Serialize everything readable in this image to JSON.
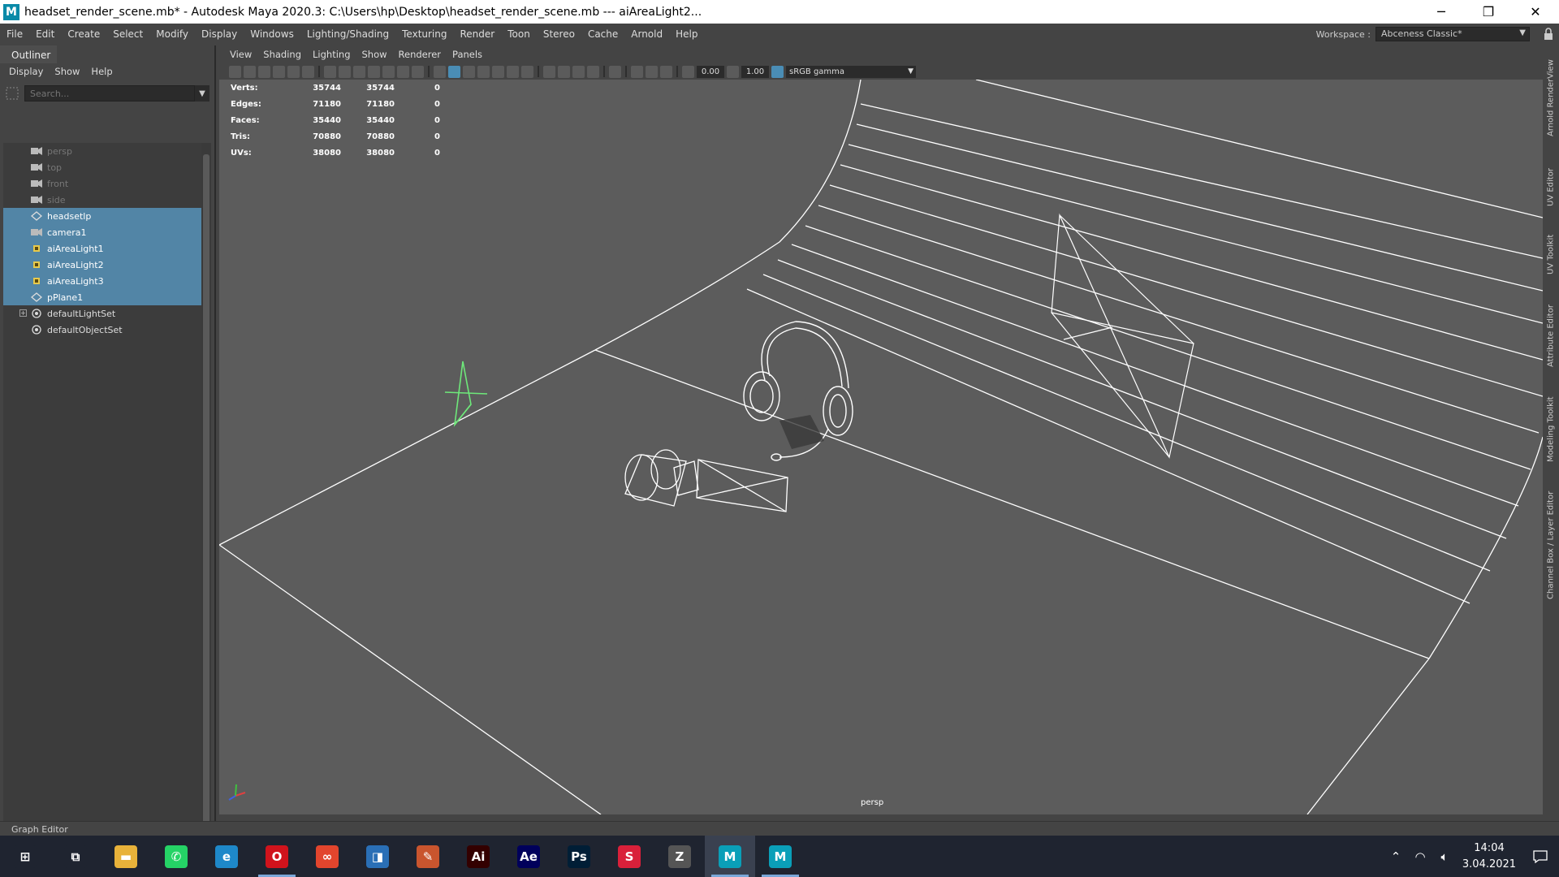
{
  "window": {
    "logo": "M",
    "title": "headset_render_scene.mb* - Autodesk Maya 2020.3: C:\\Users\\hp\\Desktop\\headset_render_scene.mb   ---   aiAreaLight2...",
    "minimize": "─",
    "restore": "❐",
    "close": "✕"
  },
  "menubar": {
    "items": [
      "File",
      "Edit",
      "Create",
      "Select",
      "Modify",
      "Display",
      "Windows",
      "Lighting/Shading",
      "Texturing",
      "Render",
      "Toon",
      "Stereo",
      "Cache",
      "Arnold",
      "Help"
    ],
    "workspace_label": "Workspace :",
    "workspace_value": "Abceness Classic*"
  },
  "outliner": {
    "tab": "Outliner",
    "menu": [
      "Display",
      "Show",
      "Help"
    ],
    "search_placeholder": "Search...",
    "items": [
      {
        "label": "persp",
        "icon": "camera-icon",
        "dim": true,
        "selected": false
      },
      {
        "label": "top",
        "icon": "camera-icon",
        "dim": true,
        "selected": false
      },
      {
        "label": "front",
        "icon": "camera-icon",
        "dim": true,
        "selected": false
      },
      {
        "label": "side",
        "icon": "camera-icon",
        "dim": true,
        "selected": false
      },
      {
        "label": "headsetlp",
        "icon": "mesh-icon",
        "dim": false,
        "selected": true
      },
      {
        "label": "camera1",
        "icon": "camera-icon",
        "dim": false,
        "selected": true
      },
      {
        "label": "aiAreaLight1",
        "icon": "light-icon",
        "dim": false,
        "selected": true
      },
      {
        "label": "aiAreaLight2",
        "icon": "light-icon",
        "dim": false,
        "selected": true
      },
      {
        "label": "aiAreaLight3",
        "icon": "light-icon",
        "dim": false,
        "selected": true
      },
      {
        "label": "pPlane1",
        "icon": "mesh-icon",
        "dim": false,
        "selected": true
      },
      {
        "label": "defaultLightSet",
        "icon": "set-icon",
        "dim": false,
        "selected": false,
        "expandable": true
      },
      {
        "label": "defaultObjectSet",
        "icon": "set-icon",
        "dim": false,
        "selected": false
      }
    ]
  },
  "viewport": {
    "menu": [
      "View",
      "Shading",
      "Lighting",
      "Show",
      "Renderer",
      "Panels"
    ],
    "exposure": "0.00",
    "gamma": "1.00",
    "color_space": "sRGB gamma",
    "camera_label": "persp",
    "hud": [
      {
        "label": "Verts:",
        "a": "35744",
        "b": "35744",
        "c": "0"
      },
      {
        "label": "Edges:",
        "a": "71180",
        "b": "71180",
        "c": "0"
      },
      {
        "label": "Faces:",
        "a": "35440",
        "b": "35440",
        "c": "0"
      },
      {
        "label": "Tris:",
        "a": "70880",
        "b": "70880",
        "c": "0"
      },
      {
        "label": "UVs:",
        "a": "38080",
        "b": "38080",
        "c": "0"
      }
    ]
  },
  "side_tabs": [
    "Arnold RenderView",
    "UV Editor",
    "UV Toolkit",
    "Attribute Editor",
    "Modeling Toolkit",
    "Channel Box / Layer Editor"
  ],
  "status_line": "Graph Editor",
  "taskbar": {
    "apps": [
      {
        "name": "windows-start-icon",
        "glyph": "⊞",
        "color": "#1f2430"
      },
      {
        "name": "task-view-icon",
        "glyph": "⧉",
        "color": "#1f2430"
      },
      {
        "name": "file-explorer-icon",
        "glyph": "▬",
        "color": "#e8b23a"
      },
      {
        "name": "whatsapp-icon",
        "glyph": "✆",
        "color": "#25d366"
      },
      {
        "name": "edge-icon",
        "glyph": "e",
        "color": "#1e88c9"
      },
      {
        "name": "opera-icon",
        "glyph": "O",
        "color": "#d0131c"
      },
      {
        "name": "creative-cloud-icon",
        "glyph": "∞",
        "color": "#e2452d"
      },
      {
        "name": "app-square-icon",
        "glyph": "◨",
        "color": "#2a6fb6"
      },
      {
        "name": "pencil-app-icon",
        "glyph": "✎",
        "color": "#c9552e"
      },
      {
        "name": "illustrator-icon",
        "glyph": "Ai",
        "color": "#330000"
      },
      {
        "name": "after-effects-icon",
        "glyph": "Ae",
        "color": "#00005b"
      },
      {
        "name": "photoshop-icon",
        "glyph": "Ps",
        "color": "#001e36"
      },
      {
        "name": "substance-icon",
        "glyph": "S",
        "color": "#d9203a"
      },
      {
        "name": "zbrush-icon",
        "glyph": "Z",
        "color": "#555"
      },
      {
        "name": "maya-icon",
        "glyph": "M",
        "color": "#0a9fb8"
      },
      {
        "name": "maya-icon-2",
        "glyph": "M",
        "color": "#0a9fb8"
      }
    ],
    "time": "14:04",
    "date": "3.04.2021"
  }
}
